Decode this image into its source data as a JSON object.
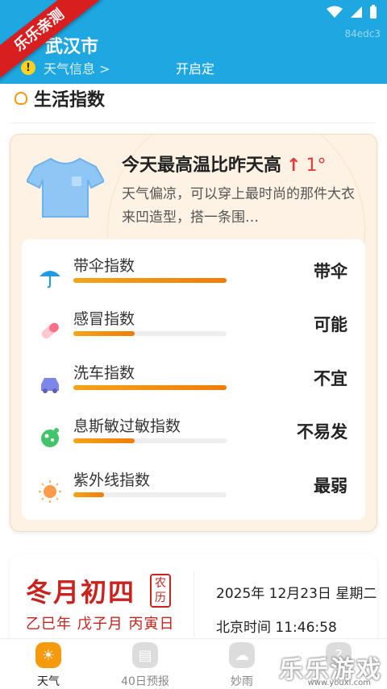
{
  "header": {
    "city": "武汉市",
    "weather_info_link": "天气信息 >",
    "locate_text": "开启定",
    "hex_text": "84edc3"
  },
  "ribbon": "乐乐亲测",
  "section": {
    "title": "生活指数"
  },
  "card": {
    "headline": "今天最高温比昨天高",
    "temp_arrow": "↑",
    "temp_diff": "1°",
    "description": "天气偏凉，可以穿上最时尚的那件大衣来凹造型，搭一条围…"
  },
  "indices": [
    {
      "label": "带伞指数",
      "value": "带伞",
      "level": 1.0,
      "icon": "umbrella-icon"
    },
    {
      "label": "感冒指数",
      "value": "可能",
      "level": 0.4,
      "icon": "pill-icon"
    },
    {
      "label": "洗车指数",
      "value": "不宜",
      "level": 1.0,
      "icon": "car-icon"
    },
    {
      "label": "息斯敏过敏指数",
      "value": "不易发",
      "level": 0.4,
      "icon": "allergy-icon"
    },
    {
      "label": "紫外线指数",
      "value": "最弱",
      "level": 0.2,
      "icon": "sun-icon"
    }
  ],
  "calendar": {
    "lunar_day": "冬月初四",
    "stamp": "农历",
    "ganzhi": "乙巳年 戊子月 丙寅日",
    "date": "2025年 12月23日 星期二",
    "time": "北京时间 11:46:58"
  },
  "nav": [
    {
      "label": "天气",
      "active": true
    },
    {
      "label": "40日预报",
      "active": false
    },
    {
      "label": "妙雨",
      "active": false
    },
    {
      "label": "",
      "active": false
    }
  ],
  "watermark": {
    "text": "乐乐游戏",
    "sub": "www.youxi.com"
  },
  "colors": {
    "accent": "#f59a0c",
    "header": "#1ea7e0",
    "warm": "#e53a3a"
  }
}
